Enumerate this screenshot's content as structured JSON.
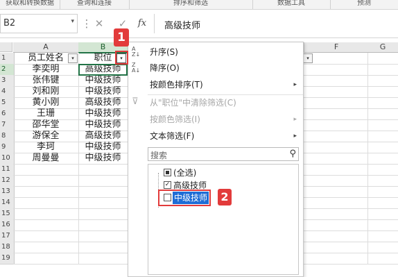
{
  "ribbon": {
    "groups": [
      "获取和转换数据",
      "查询和连接",
      "排序和筛选",
      "数据工具",
      "预测"
    ]
  },
  "formula_bar": {
    "name_box": "B2",
    "name_box_dropdown": "▾",
    "more": "⋮",
    "cancel": "✕",
    "enter": "✓",
    "fx": "fx",
    "formula": "高级技师"
  },
  "columns": [
    "A",
    "B",
    "C",
    "F",
    "G"
  ],
  "rows": [
    "1",
    "2",
    "3",
    "4",
    "5",
    "6",
    "7",
    "8",
    "9",
    "10",
    "11",
    "12",
    "13",
    "14",
    "15",
    "16",
    "17",
    "18",
    "19"
  ],
  "table": {
    "headers": [
      "员工姓名",
      "职位"
    ],
    "data": [
      [
        "李奕明",
        "高级技师"
      ],
      [
        "张伟键",
        "中级技师"
      ],
      [
        "刘和刚",
        "中级技师"
      ],
      [
        "黄小刚",
        "高级技师"
      ],
      [
        "王珊",
        "中级技师"
      ],
      [
        "邵华堂",
        "中级技师"
      ],
      [
        "游保全",
        "高级技师"
      ],
      [
        "李珂",
        "中级技师"
      ],
      [
        "周曼曼",
        "中级技师"
      ]
    ]
  },
  "filter_button_glyph": "▾",
  "menu": {
    "sort_asc": "升序(S)",
    "sort_desc": "降序(O)",
    "sort_by_color": "按颜色排序(T)",
    "clear_filter": "从\"职位\"中清除筛选(C)",
    "filter_by_color": "按颜色筛选(I)",
    "text_filter": "文本筛选(F)",
    "submenu_arrow": "▸",
    "search_placeholder": "搜索",
    "search_icon": "⚲",
    "items": [
      "(全选)",
      "高级技师",
      "中级技师"
    ],
    "checked_mark": "✓"
  },
  "annotations": {
    "step1": "1",
    "step2": "2"
  },
  "colors": {
    "accent": "#217346",
    "annotation_red": "#e23b3b",
    "highlight": "#1e6dd6"
  }
}
